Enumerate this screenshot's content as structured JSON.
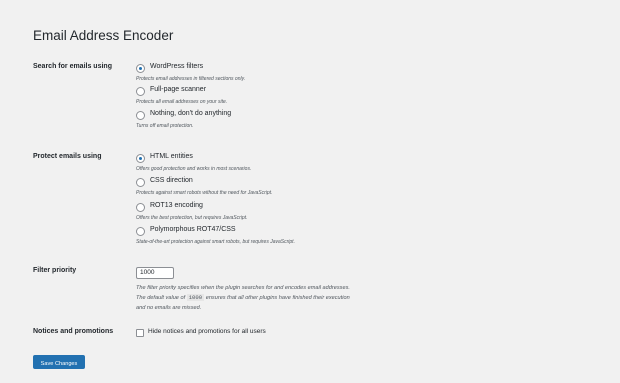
{
  "page": {
    "title": "Email Address Encoder"
  },
  "search_section": {
    "label": "Search for emails using",
    "options": [
      {
        "label": "WordPress filters",
        "description": "Protects email addresses in filtered sections only.",
        "checked": true
      },
      {
        "label": "Full-page scanner",
        "description": "Protects all email addresses on your site.",
        "checked": false
      },
      {
        "label": "Nothing, don't do anything",
        "description": "Turns off email protection.",
        "checked": false
      }
    ]
  },
  "protect_section": {
    "label": "Protect emails using",
    "options": [
      {
        "label": "HTML entities",
        "description": "Offers good protection and works in most scenarios.",
        "checked": true
      },
      {
        "label": "CSS direction",
        "description": "Protects against smart robots without the need for JavaScript.",
        "checked": false
      },
      {
        "label": "ROT13 encoding",
        "description": "Offers the best protection, but requires JavaScript.",
        "checked": false
      },
      {
        "label": "Polymorphous ROT47/CSS",
        "description": "State-of-the-art protection against smart robots, but requires JavaScript.",
        "checked": false
      }
    ]
  },
  "priority_section": {
    "label": "Filter priority",
    "value": "1000",
    "help_line1": "The filter priority specifies when the plugin searches for and encodes email addresses.",
    "help_pre": "The default value of",
    "help_code": "1000",
    "help_post": "ensures that all other plugins have finished their execution",
    "help_line3": "and no emails are missed."
  },
  "notices_section": {
    "label": "Notices and promotions",
    "checkbox_label": "Hide notices and promotions for all users"
  },
  "actions": {
    "save_label": "Save Changes"
  },
  "colors": {
    "accent": "#2271b1",
    "background": "#f1f1f1"
  }
}
